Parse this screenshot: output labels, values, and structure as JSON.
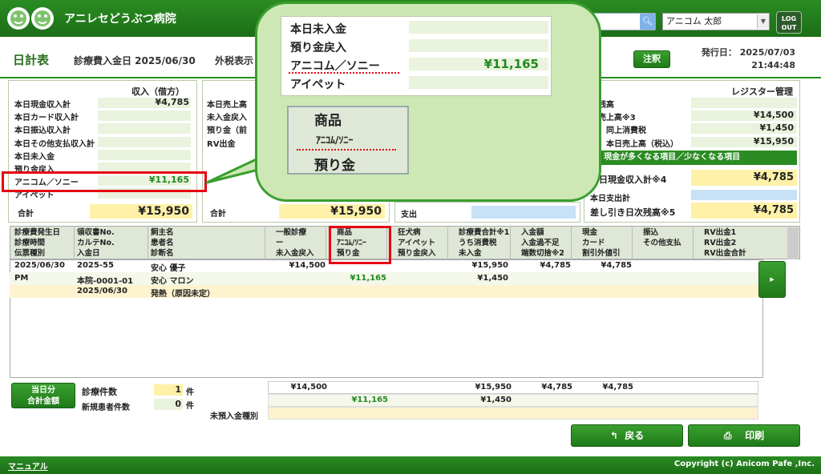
{
  "app": {
    "name": "アニレセどうぶつ病院",
    "search_icon": "search-icon",
    "user": "アニコム 太郎",
    "logout_line1": "LOG",
    "logout_line2": "OUT"
  },
  "header": {
    "title": "日計表",
    "date_label": "診療費入金日 2025/06/30",
    "tax_label": "外税表示",
    "note_button": "注釈",
    "issue_label": "発行日：",
    "issue_date": "2025/07/03",
    "issue_time": "21:44:48"
  },
  "income_panel": {
    "title": "収入（借方）",
    "rows": [
      {
        "label": "本日現金収入計",
        "value": "¥4,785"
      },
      {
        "label": "本日カード収入計",
        "value": ""
      },
      {
        "label": "本日振込収入計",
        "value": ""
      },
      {
        "label": "本日その他支払収入計",
        "value": ""
      },
      {
        "label": "本日未入金",
        "value": ""
      },
      {
        "label": "預り金戻入",
        "value": ""
      },
      {
        "label": "アニコム／ソニー",
        "value": "¥11,165"
      },
      {
        "label": "アイペット",
        "value": ""
      }
    ],
    "total_label": "合計",
    "total_value": "¥15,950"
  },
  "sales_panel": {
    "rows": [
      {
        "label": "本日売上高"
      },
      {
        "label": "未入金戻入"
      },
      {
        "label": "預り金（前"
      },
      {
        "label": "RV出金"
      }
    ],
    "total_label": "合計",
    "total_value": "¥15,950",
    "expense_label": "支出"
  },
  "register_panel": {
    "title": "レジスター管理",
    "rows": [
      {
        "label": "期残高",
        "value": ""
      },
      {
        "label": "日売上高※3",
        "value": "¥14,500"
      },
      {
        "label": "同上消費税",
        "value": "¥1,450"
      },
      {
        "label": "本日売上高（税込）",
        "value": "¥15,950"
      }
    ],
    "band": "現金が多くなる項目／少なくなる項目",
    "cash_label": "本日現金収入計※4",
    "cash_value": "¥4,785",
    "expense_label": "本日支出計",
    "balance_label": "差し引き日次残高※5",
    "balance_value": "¥4,785"
  },
  "callout": {
    "rows": [
      {
        "label": "本日未入金",
        "value": ""
      },
      {
        "label": "預り金戻入",
        "value": ""
      },
      {
        "label": "アニコム／ソニー",
        "value": "¥11,165"
      },
      {
        "label": "アイペット",
        "value": ""
      }
    ],
    "header_line1": "商品",
    "header_line2": "ｱﾆｺﾑ/ｿﾆｰ",
    "header_line3": "預り金"
  },
  "grid": {
    "columns": [
      [
        "診療費発生日",
        "診療時間",
        "伝票種別"
      ],
      [
        "領収書No.",
        "カルテNo.",
        "入金日"
      ],
      [
        "飼主名",
        "患者名",
        "診断名"
      ],
      [
        "一般診療",
        "ー",
        "未入金戻入"
      ],
      [
        "商品",
        "ｱﾆｺﾑ/ｿﾆｰ",
        "預り金"
      ],
      [
        "狂犬病",
        "アイペット",
        "預り金戻入"
      ],
      [
        "診療費合計※1",
        "うち消費税",
        "未入金"
      ],
      [
        "入金額",
        "入金過不足",
        "端数切捨※2"
      ],
      [
        "現金",
        "カード",
        "割引外値引"
      ],
      [
        "振込",
        "その他支払"
      ],
      [
        "RV出金1",
        "RV出金2",
        "RV出金合計"
      ]
    ],
    "row1": [
      "2025/06/30",
      "2025-55",
      "安心 優子",
      "¥14,500",
      "",
      "",
      "¥15,950",
      "¥4,785",
      "¥4,785"
    ],
    "row2": [
      "PM",
      "本院-0001-01",
      "安心 マロン",
      "",
      "¥11,165",
      "",
      "¥1,450"
    ],
    "row3": [
      "",
      "2025/06/30",
      "発熱（原因未定）"
    ]
  },
  "summary": {
    "label1": "当日分",
    "label2": "合計金額",
    "count_label": "診療件数",
    "count_value": "1",
    "count_unit": "件",
    "new_label": "新規患者件数",
    "new_value": "0",
    "new_unit": "件",
    "unpaid_label": "未預入金種別",
    "r1": [
      "¥14,500",
      "¥15,950",
      "¥4,785",
      "¥4,785"
    ],
    "r2": [
      "¥11,165",
      "¥1,450"
    ]
  },
  "actions": {
    "back": "戻る",
    "print": "印刷"
  },
  "footer": {
    "manual": "マニュアル",
    "copyright": "Copyright (c) Anicom Pafe ,Inc."
  }
}
